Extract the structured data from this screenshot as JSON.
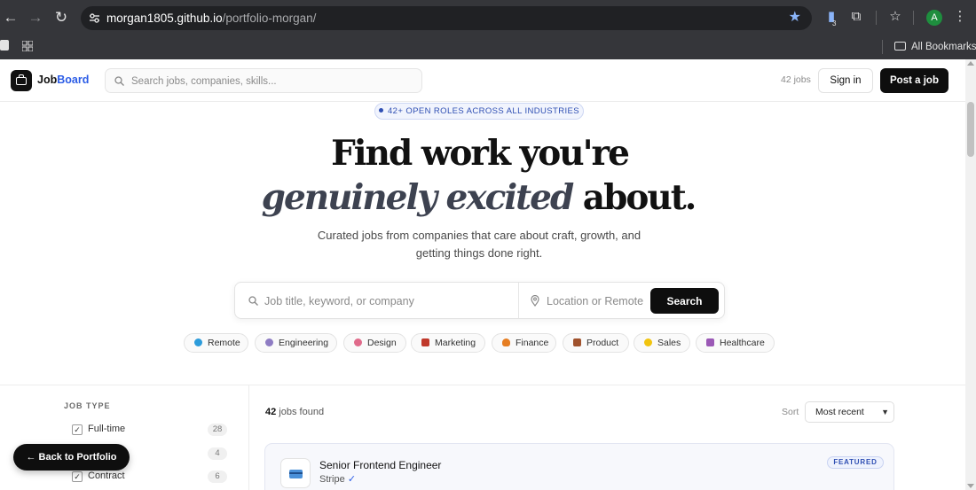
{
  "browser": {
    "url_host": "morgan1805.github.io",
    "url_path": "/portfolio-morgan/",
    "bookmarks_folder": "All Bookmarks",
    "extension_badge": "3",
    "profile_initial": "A"
  },
  "header": {
    "brand_prefix": "Job",
    "brand_accent": "Board",
    "search_placeholder": "Search jobs, companies, skills...",
    "jobs_count": "42 jobs",
    "sign_in": "Sign in",
    "post_job": "Post a job"
  },
  "hero": {
    "pill": "42+ OPEN ROLES ACROSS ALL INDUSTRIES",
    "line1": "Find work you're",
    "line2_em": "genuinely excited",
    "line2_rest": " about.",
    "subtitle": "Curated jobs from companies that care about craft, growth, and getting things done right."
  },
  "search": {
    "query_placeholder": "Job title, keyword, or company",
    "location_placeholder": "Location or Remote",
    "button": "Search"
  },
  "categories": [
    {
      "label": "Remote",
      "color": "#2d9cdb"
    },
    {
      "label": "Engineering",
      "color": "#8e7cc3"
    },
    {
      "label": "Design",
      "color": "#e06b8b"
    },
    {
      "label": "Marketing",
      "color": "#c0392b"
    },
    {
      "label": "Finance",
      "color": "#e67e22"
    },
    {
      "label": "Product",
      "color": "#a0522d"
    },
    {
      "label": "Sales",
      "color": "#f1c40f"
    },
    {
      "label": "Healthcare",
      "color": "#9b59b6"
    }
  ],
  "filters": {
    "title": "JOB TYPE",
    "items": [
      {
        "label": "Full-time",
        "count": "28"
      },
      {
        "label": "",
        "count": "4"
      },
      {
        "label": "Contract",
        "count": "6"
      }
    ]
  },
  "results": {
    "count": "42",
    "suffix": " jobs found",
    "sort_label": "Sort",
    "sort_value": "Most recent"
  },
  "job": {
    "title": "Senior Frontend Engineer",
    "company": "Stripe",
    "verified": "✓",
    "badge": "FEATURED"
  },
  "back_button": "← Back to Portfolio",
  "colors": {
    "accent": "#2b5ce6",
    "primary_button": "#0e0e0e",
    "pill_text": "#2f4fb3"
  }
}
